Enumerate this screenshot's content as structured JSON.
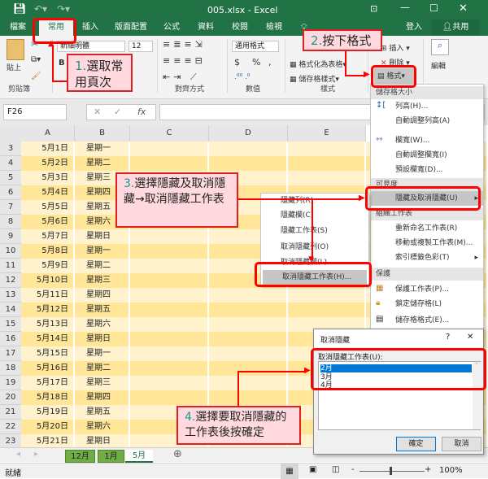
{
  "window": {
    "title": "005.xlsx - Excel",
    "save_icon": "save-icon",
    "undo_icon": "undo-icon",
    "redo_icon": "redo-icon"
  },
  "tabs": [
    "檔案",
    "常用",
    "插入",
    "版面配置",
    "公式",
    "資料",
    "校閱",
    "檢視"
  ],
  "account": {
    "login": "登入",
    "share": "共用"
  },
  "ribbon": {
    "paste": "貼上",
    "clipboard": "剪貼簿",
    "font_name": "新細明體",
    "font_size": "12",
    "bold": "B",
    "alignment": "對齊方式",
    "number_format": "通用格式",
    "currency": "$",
    "percent": "%",
    "comma": ",",
    "number": "數值",
    "format_as_table": "格式化為表格",
    "cell_styles": "儲存格樣式",
    "styles": "樣式",
    "insert": "插入",
    "delete": "刪除",
    "format": "格式",
    "edit": "編輯"
  },
  "formula_bar": {
    "name_box": "F26",
    "cancel": "✕",
    "enter": "✓",
    "fx": "fx",
    "value": ""
  },
  "columns": [
    "A",
    "B",
    "C",
    "D",
    "E"
  ],
  "rows": [
    {
      "n": "3",
      "a": "5月1日",
      "b": "星期一"
    },
    {
      "n": "4",
      "a": "5月2日",
      "b": "星期二"
    },
    {
      "n": "5",
      "a": "5月3日",
      "b": "星期三"
    },
    {
      "n": "6",
      "a": "5月4日",
      "b": "星期四"
    },
    {
      "n": "7",
      "a": "5月5日",
      "b": "星期五"
    },
    {
      "n": "8",
      "a": "5月6日",
      "b": "星期六"
    },
    {
      "n": "9",
      "a": "5月7日",
      "b": "星期日"
    },
    {
      "n": "10",
      "a": "5月8日",
      "b": "星期一"
    },
    {
      "n": "11",
      "a": "5月9日",
      "b": "星期二"
    },
    {
      "n": "12",
      "a": "5月10日",
      "b": "星期三"
    },
    {
      "n": "13",
      "a": "5月11日",
      "b": "星期四"
    },
    {
      "n": "14",
      "a": "5月12日",
      "b": "星期五"
    },
    {
      "n": "15",
      "a": "5月13日",
      "b": "星期六"
    },
    {
      "n": "16",
      "a": "5月14日",
      "b": "星期日"
    },
    {
      "n": "17",
      "a": "5月15日",
      "b": "星期一"
    },
    {
      "n": "18",
      "a": "5月16日",
      "b": "星期二"
    },
    {
      "n": "19",
      "a": "5月17日",
      "b": "星期三"
    },
    {
      "n": "20",
      "a": "5月18日",
      "b": "星期四"
    },
    {
      "n": "21",
      "a": "5月19日",
      "b": "星期五"
    },
    {
      "n": "22",
      "a": "5月20日",
      "b": "星期六"
    },
    {
      "n": "23",
      "a": "5月21日",
      "b": "星期日"
    }
  ],
  "format_menu": {
    "h1": "儲存格大小",
    "row_height": "列高(H)...",
    "autofit_row": "自動調整列高(A)",
    "col_width": "欄寬(W)...",
    "autofit_col": "自動調整欄寬(I)",
    "default_width": "預設欄寬(D)...",
    "h2": "可見度",
    "hide_unhide": "隱藏及取消隱藏(U)",
    "h3": "組織工作表",
    "rename": "重新命名工作表(R)",
    "move_copy": "移動或複製工作表(M)...",
    "tab_color": "索引標籤色彩(T)",
    "h4": "保護",
    "protect": "保護工作表(P)...",
    "lock": "鎖定儲存格(L)",
    "format_cells": "儲存格格式(E)..."
  },
  "submenu": [
    "隱藏列(R)",
    "隱藏欄(C)",
    "隱藏工作表(S)",
    "取消隱藏列(O)",
    "取消隱藏欄(L)",
    "取消隱藏工作表(H)..."
  ],
  "dialog": {
    "title": "取消隱藏",
    "help": "?",
    "close": "✕",
    "label": "取消隱藏工作表(U):",
    "items": [
      "2月",
      "3月",
      "4月"
    ],
    "ok": "確定",
    "cancel": "取消"
  },
  "sheets": [
    "12月",
    "1月",
    "5月"
  ],
  "status": {
    "ready": "就緒",
    "zoom": "100%",
    "minus": "-",
    "plus": "+"
  },
  "callouts": {
    "c1n": "1.",
    "c1": "選取常用頁次",
    "c2n": "2.",
    "c2": "按下格式",
    "c3n": "3.",
    "c3": "選擇隱藏及取消隱藏→取消隱藏工作表",
    "c4n": "4.",
    "c4": "選擇要取消隱藏的工作表後按確定"
  },
  "colors": {
    "excel_green": "#217346",
    "row_light": "#fff2cc",
    "row_dark": "#ffe699",
    "highlight": "#ff0000",
    "callout_bg": "#ffd9de"
  }
}
